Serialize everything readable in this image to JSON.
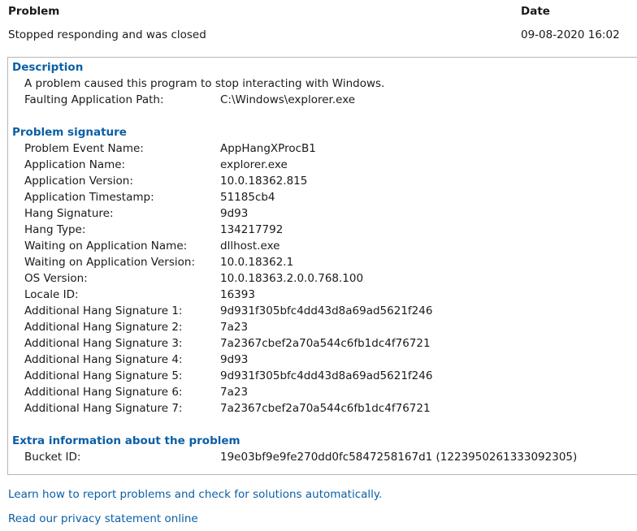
{
  "header": {
    "problem_label": "Problem",
    "date_label": "Date",
    "problem_value": "Stopped responding and was closed",
    "date_value": "09-08-2020 16:02"
  },
  "description": {
    "title": "Description",
    "message": "A problem caused this program to stop interacting with Windows.",
    "rows": [
      {
        "label": "Faulting Application Path:",
        "value": "C:\\Windows\\explorer.exe"
      }
    ]
  },
  "signature": {
    "title": "Problem signature",
    "rows": [
      {
        "label": "Problem Event Name:",
        "value": "AppHangXProcB1"
      },
      {
        "label": "Application Name:",
        "value": "explorer.exe"
      },
      {
        "label": "Application Version:",
        "value": "10.0.18362.815"
      },
      {
        "label": "Application Timestamp:",
        "value": "51185cb4"
      },
      {
        "label": "Hang Signature:",
        "value": "9d93"
      },
      {
        "label": "Hang Type:",
        "value": "134217792"
      },
      {
        "label": "Waiting on Application Name:",
        "value": "dllhost.exe"
      },
      {
        "label": "Waiting on Application Version:",
        "value": "10.0.18362.1"
      },
      {
        "label": "OS Version:",
        "value": "10.0.18363.2.0.0.768.100"
      },
      {
        "label": "Locale ID:",
        "value": "16393"
      },
      {
        "label": "Additional Hang Signature 1:",
        "value": "9d931f305bfc4dd43d8a69ad5621f246"
      },
      {
        "label": "Additional Hang Signature 2:",
        "value": "7a23"
      },
      {
        "label": "Additional Hang Signature 3:",
        "value": "7a2367cbef2a70a544c6fb1dc4f76721"
      },
      {
        "label": "Additional Hang Signature 4:",
        "value": "9d93"
      },
      {
        "label": "Additional Hang Signature 5:",
        "value": "9d931f305bfc4dd43d8a69ad5621f246"
      },
      {
        "label": "Additional Hang Signature 6:",
        "value": "7a23"
      },
      {
        "label": "Additional Hang Signature 7:",
        "value": "7a2367cbef2a70a544c6fb1dc4f76721"
      }
    ]
  },
  "extra": {
    "title": "Extra information about the problem",
    "rows": [
      {
        "label": "Bucket ID:",
        "value": "19e03bf9e9fe270dd0fc5847258167d1 (1223950261333092305)"
      }
    ]
  },
  "links": {
    "report": "Learn how to report problems and check for solutions automatically.",
    "privacy": "Read our privacy statement online"
  },
  "colors": {
    "accent": "#0b5fa5",
    "border": "#b6b6b6",
    "text": "#1a1a1a"
  }
}
